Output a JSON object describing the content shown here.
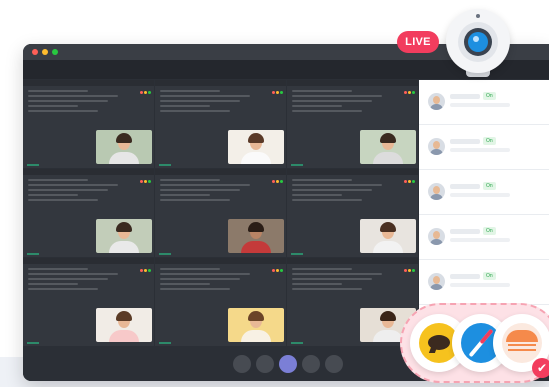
{
  "live_badge": "LIVE",
  "participants": [
    {
      "status": "On"
    },
    {
      "status": "On"
    },
    {
      "status": "On"
    },
    {
      "status": "On"
    },
    {
      "status": "On"
    }
  ],
  "colors": {
    "live_badge_bg": "#f23d5e",
    "accent_active_control": "#7b7fd6",
    "status_on": "#2aa84a",
    "app_tray_bg": "#fde1e6"
  },
  "icons": {
    "webcam": "webcam-icon",
    "chat": "chat-bubble-icon",
    "compass": "compass-icon",
    "notes": "notes-icon",
    "check": "check-icon"
  },
  "controls": {
    "count": 5,
    "active_index": 2
  }
}
